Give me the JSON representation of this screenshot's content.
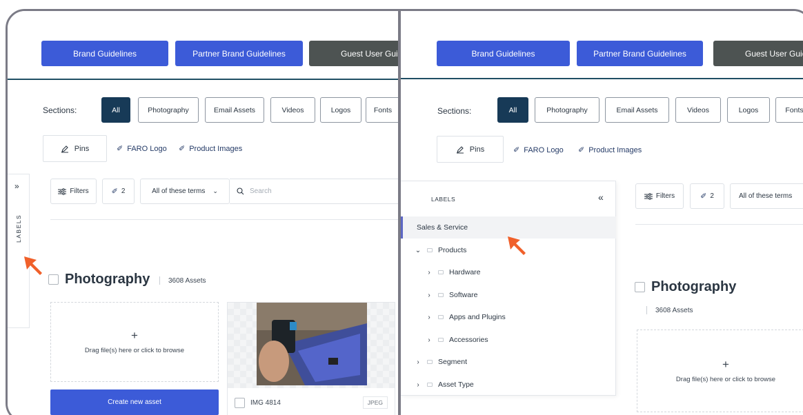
{
  "top_nav": {
    "buttons": [
      "Brand Guidelines",
      "Partner Brand Guidelines",
      "Guest User Guide"
    ]
  },
  "sections": {
    "label": "Sections:",
    "tabs": [
      "All",
      "Photography",
      "Email Assets",
      "Videos",
      "Logos",
      "Fonts"
    ]
  },
  "pins": {
    "pins_label": "Pins",
    "links": [
      "FARO Logo",
      "Product Images"
    ]
  },
  "filterbar": {
    "filters_label": "Filters",
    "pin_count": "2",
    "terms_select": "All of these terms",
    "search_placeholder": "Search"
  },
  "labels_sidebar": {
    "tab_label": "LABELS",
    "panel_title": "LABELS",
    "tree": [
      {
        "label": "Sales & Service",
        "caret": "",
        "level": 0,
        "selected": true
      },
      {
        "label": "Products",
        "caret": "⌄",
        "level": 0
      },
      {
        "label": "Hardware",
        "caret": "›",
        "level": 1
      },
      {
        "label": "Software",
        "caret": "›",
        "level": 1
      },
      {
        "label": "Apps and Plugins",
        "caret": "›",
        "level": 1
      },
      {
        "label": "Accessories",
        "caret": "›",
        "level": 1
      },
      {
        "label": "Segment",
        "caret": "›",
        "level": 0
      },
      {
        "label": "Asset Type",
        "caret": "›",
        "level": 0
      }
    ]
  },
  "section_header": {
    "title": "Photography",
    "asset_count": "3608 Assets"
  },
  "upload": {
    "plus": "+",
    "text": "Drag file(s) here or click to browse",
    "create_label": "Create new asset"
  },
  "asset": {
    "name": "IMG 4814",
    "type": "JPEG"
  },
  "colors": {
    "accent_blue": "#3c5bd8",
    "active_tab": "#173a57",
    "arrow_orange": "#f0602a"
  }
}
